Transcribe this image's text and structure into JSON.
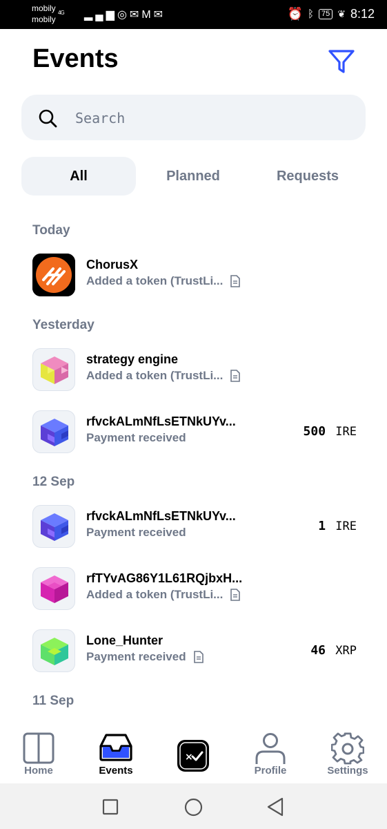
{
  "status_bar": {
    "carrier_1": "mobily",
    "carrier_2": "mobily",
    "network": "4G",
    "battery": "75",
    "time": "8:12"
  },
  "header": {
    "title": "Events",
    "filter_icon": "filter-icon"
  },
  "search": {
    "placeholder": "Search",
    "icon": "search-icon"
  },
  "tabs": [
    {
      "label": "All",
      "active": true
    },
    {
      "label": "Planned",
      "active": false
    },
    {
      "label": "Requests",
      "active": false
    }
  ],
  "sections": [
    {
      "title": "Today",
      "events": [
        {
          "title": "ChorusX",
          "subtitle": "Added a token (TrustLi...",
          "has_doc_icon": true,
          "amount": "",
          "currency": "",
          "avatar": "chorusx-logo"
        }
      ]
    },
    {
      "title": "Yesterday",
      "events": [
        {
          "title": "strategy engine",
          "subtitle": "Added a token (TrustLi...",
          "has_doc_icon": true,
          "amount": "",
          "currency": "",
          "avatar": "hash-cube-yellow-pink"
        },
        {
          "title": "rfvckALmNfLsETNkUYv...",
          "subtitle": "Payment received",
          "has_doc_icon": false,
          "amount": "500",
          "currency": "IRE",
          "avatar": "hash-cube-blue-purple"
        }
      ]
    },
    {
      "title": "12 Sep",
      "events": [
        {
          "title": "rfvckALmNfLsETNkUYv...",
          "subtitle": "Payment received",
          "has_doc_icon": false,
          "amount": "1",
          "currency": "IRE",
          "avatar": "hash-cube-blue-purple"
        },
        {
          "title": "rfTYvAG86Y1L61RQjbxH...",
          "subtitle": "Added a token (TrustLi...",
          "has_doc_icon": true,
          "amount": "",
          "currency": "",
          "avatar": "hash-cube-magenta"
        },
        {
          "title": "Lone_Hunter",
          "subtitle": "Payment received",
          "has_doc_icon": true,
          "amount": "46",
          "currency": "XRP",
          "avatar": "hash-cube-green"
        }
      ]
    },
    {
      "title": "11 Sep",
      "events": []
    }
  ],
  "bottom_nav": [
    {
      "label": "Home",
      "icon": "home-icon",
      "active": false
    },
    {
      "label": "Events",
      "icon": "inbox-icon",
      "active": true
    },
    {
      "label": "",
      "icon": "xumm-scan-icon",
      "active": false
    },
    {
      "label": "Profile",
      "icon": "profile-icon",
      "active": false
    },
    {
      "label": "Settings",
      "icon": "gear-icon",
      "active": false
    }
  ],
  "colors": {
    "accent": "#3052ff",
    "muted_text": "#6f7889",
    "surface": "#f0f3f7"
  }
}
